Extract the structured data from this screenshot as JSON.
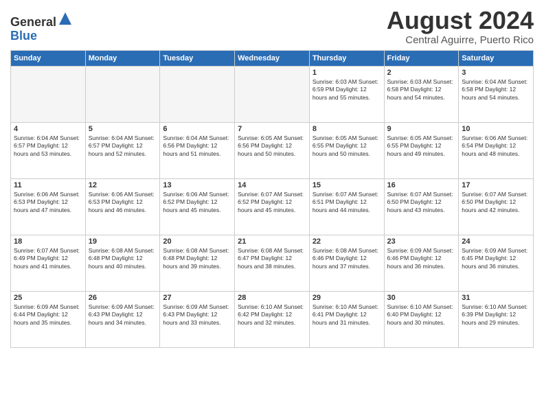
{
  "header": {
    "logo_general": "General",
    "logo_blue": "Blue",
    "month_title": "August 2024",
    "location": "Central Aguirre, Puerto Rico"
  },
  "weekdays": [
    "Sunday",
    "Monday",
    "Tuesday",
    "Wednesday",
    "Thursday",
    "Friday",
    "Saturday"
  ],
  "weeks": [
    [
      {
        "day": "",
        "detail": ""
      },
      {
        "day": "",
        "detail": ""
      },
      {
        "day": "",
        "detail": ""
      },
      {
        "day": "",
        "detail": ""
      },
      {
        "day": "1",
        "detail": "Sunrise: 6:03 AM\nSunset: 6:59 PM\nDaylight: 12 hours\nand 55 minutes."
      },
      {
        "day": "2",
        "detail": "Sunrise: 6:03 AM\nSunset: 6:58 PM\nDaylight: 12 hours\nand 54 minutes."
      },
      {
        "day": "3",
        "detail": "Sunrise: 6:04 AM\nSunset: 6:58 PM\nDaylight: 12 hours\nand 54 minutes."
      }
    ],
    [
      {
        "day": "4",
        "detail": "Sunrise: 6:04 AM\nSunset: 6:57 PM\nDaylight: 12 hours\nand 53 minutes."
      },
      {
        "day": "5",
        "detail": "Sunrise: 6:04 AM\nSunset: 6:57 PM\nDaylight: 12 hours\nand 52 minutes."
      },
      {
        "day": "6",
        "detail": "Sunrise: 6:04 AM\nSunset: 6:56 PM\nDaylight: 12 hours\nand 51 minutes."
      },
      {
        "day": "7",
        "detail": "Sunrise: 6:05 AM\nSunset: 6:56 PM\nDaylight: 12 hours\nand 50 minutes."
      },
      {
        "day": "8",
        "detail": "Sunrise: 6:05 AM\nSunset: 6:55 PM\nDaylight: 12 hours\nand 50 minutes."
      },
      {
        "day": "9",
        "detail": "Sunrise: 6:05 AM\nSunset: 6:55 PM\nDaylight: 12 hours\nand 49 minutes."
      },
      {
        "day": "10",
        "detail": "Sunrise: 6:06 AM\nSunset: 6:54 PM\nDaylight: 12 hours\nand 48 minutes."
      }
    ],
    [
      {
        "day": "11",
        "detail": "Sunrise: 6:06 AM\nSunset: 6:53 PM\nDaylight: 12 hours\nand 47 minutes."
      },
      {
        "day": "12",
        "detail": "Sunrise: 6:06 AM\nSunset: 6:53 PM\nDaylight: 12 hours\nand 46 minutes."
      },
      {
        "day": "13",
        "detail": "Sunrise: 6:06 AM\nSunset: 6:52 PM\nDaylight: 12 hours\nand 45 minutes."
      },
      {
        "day": "14",
        "detail": "Sunrise: 6:07 AM\nSunset: 6:52 PM\nDaylight: 12 hours\nand 45 minutes."
      },
      {
        "day": "15",
        "detail": "Sunrise: 6:07 AM\nSunset: 6:51 PM\nDaylight: 12 hours\nand 44 minutes."
      },
      {
        "day": "16",
        "detail": "Sunrise: 6:07 AM\nSunset: 6:50 PM\nDaylight: 12 hours\nand 43 minutes."
      },
      {
        "day": "17",
        "detail": "Sunrise: 6:07 AM\nSunset: 6:50 PM\nDaylight: 12 hours\nand 42 minutes."
      }
    ],
    [
      {
        "day": "18",
        "detail": "Sunrise: 6:07 AM\nSunset: 6:49 PM\nDaylight: 12 hours\nand 41 minutes."
      },
      {
        "day": "19",
        "detail": "Sunrise: 6:08 AM\nSunset: 6:48 PM\nDaylight: 12 hours\nand 40 minutes."
      },
      {
        "day": "20",
        "detail": "Sunrise: 6:08 AM\nSunset: 6:48 PM\nDaylight: 12 hours\nand 39 minutes."
      },
      {
        "day": "21",
        "detail": "Sunrise: 6:08 AM\nSunset: 6:47 PM\nDaylight: 12 hours\nand 38 minutes."
      },
      {
        "day": "22",
        "detail": "Sunrise: 6:08 AM\nSunset: 6:46 PM\nDaylight: 12 hours\nand 37 minutes."
      },
      {
        "day": "23",
        "detail": "Sunrise: 6:09 AM\nSunset: 6:46 PM\nDaylight: 12 hours\nand 36 minutes."
      },
      {
        "day": "24",
        "detail": "Sunrise: 6:09 AM\nSunset: 6:45 PM\nDaylight: 12 hours\nand 36 minutes."
      }
    ],
    [
      {
        "day": "25",
        "detail": "Sunrise: 6:09 AM\nSunset: 6:44 PM\nDaylight: 12 hours\nand 35 minutes."
      },
      {
        "day": "26",
        "detail": "Sunrise: 6:09 AM\nSunset: 6:43 PM\nDaylight: 12 hours\nand 34 minutes."
      },
      {
        "day": "27",
        "detail": "Sunrise: 6:09 AM\nSunset: 6:43 PM\nDaylight: 12 hours\nand 33 minutes."
      },
      {
        "day": "28",
        "detail": "Sunrise: 6:10 AM\nSunset: 6:42 PM\nDaylight: 12 hours\nand 32 minutes."
      },
      {
        "day": "29",
        "detail": "Sunrise: 6:10 AM\nSunset: 6:41 PM\nDaylight: 12 hours\nand 31 minutes."
      },
      {
        "day": "30",
        "detail": "Sunrise: 6:10 AM\nSunset: 6:40 PM\nDaylight: 12 hours\nand 30 minutes."
      },
      {
        "day": "31",
        "detail": "Sunrise: 6:10 AM\nSunset: 6:39 PM\nDaylight: 12 hours\nand 29 minutes."
      }
    ]
  ]
}
